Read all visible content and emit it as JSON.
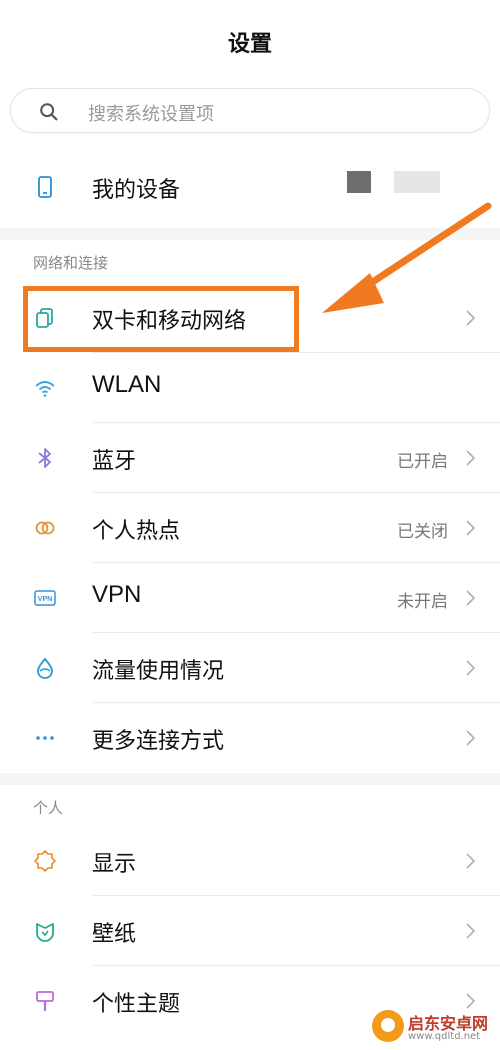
{
  "header": {
    "title": "设置"
  },
  "search": {
    "placeholder": "搜索系统设置项",
    "icon": "search-icon"
  },
  "device": {
    "label": "我的设备",
    "icon": "phone-icon"
  },
  "sections": [
    {
      "title": "网络和连接",
      "items": [
        {
          "label": "双卡和移动网络",
          "status": "",
          "icon": "sim-card-icon"
        },
        {
          "label": "WLAN",
          "status": "",
          "icon": "wifi-icon"
        },
        {
          "label": "蓝牙",
          "status": "已开启",
          "icon": "bluetooth-icon"
        },
        {
          "label": "个人热点",
          "status": "已关闭",
          "icon": "hotspot-icon"
        },
        {
          "label": "VPN",
          "status": "未开启",
          "icon": "vpn-icon"
        },
        {
          "label": "流量使用情况",
          "status": "",
          "icon": "data-usage-icon"
        },
        {
          "label": "更多连接方式",
          "status": "",
          "icon": "more-dots-icon"
        }
      ]
    },
    {
      "title": "个人",
      "items": [
        {
          "label": "显示",
          "status": "",
          "icon": "brightness-icon"
        },
        {
          "label": "壁纸",
          "status": "",
          "icon": "wallpaper-icon"
        },
        {
          "label": "个性主题",
          "status": "",
          "icon": "theme-brush-icon"
        }
      ]
    }
  ],
  "annotation": {
    "color": "#f07a20"
  },
  "watermark": {
    "brand": "启东安卓网",
    "url": "www.qdltd.net"
  },
  "colors": {
    "accent": "#f07a20",
    "divider": "#ececec",
    "section_gap": "#f5f5f5"
  }
}
